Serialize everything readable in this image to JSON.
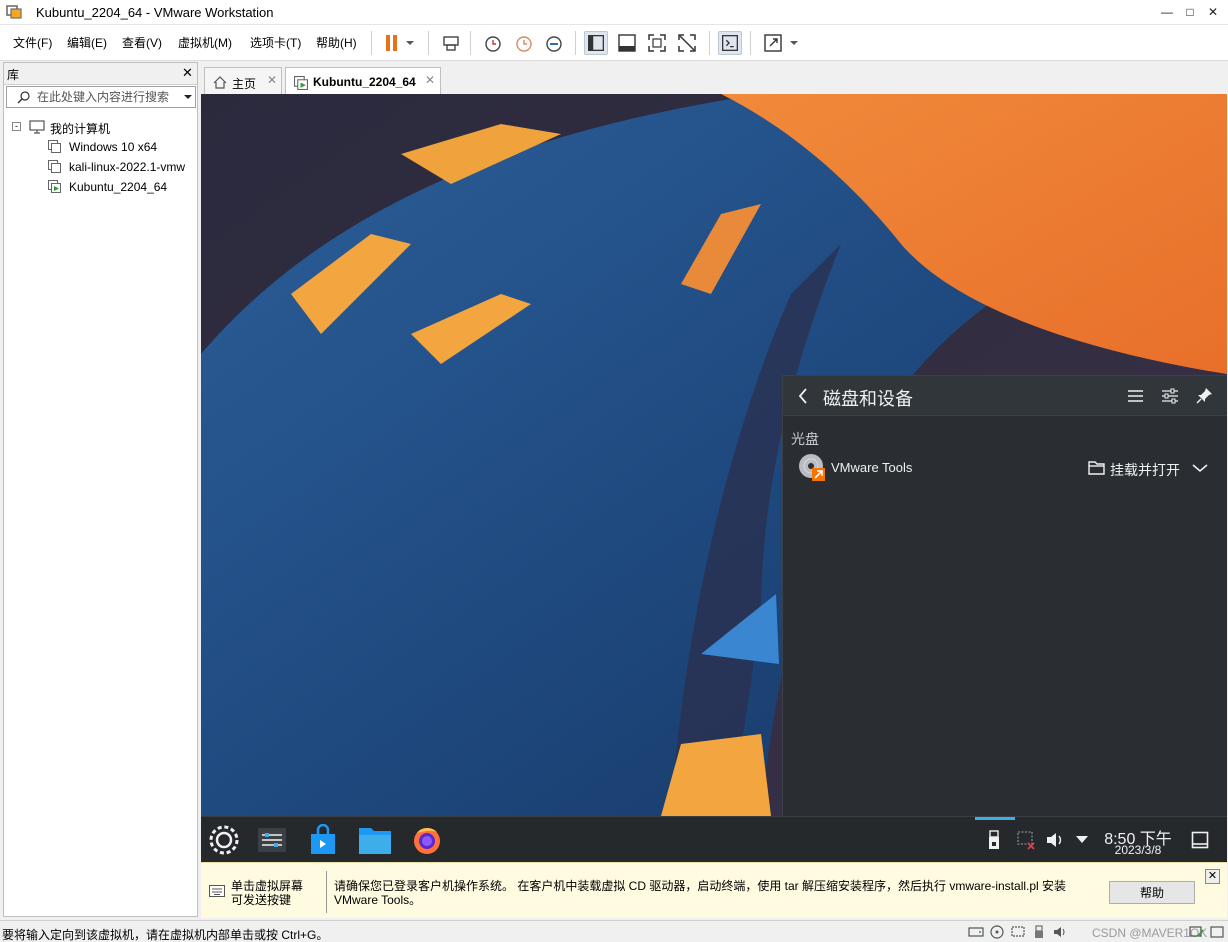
{
  "window": {
    "title": "Kubuntu_2204_64 - VMware Workstation"
  },
  "menu": [
    "文件(F)",
    "编辑(E)",
    "查看(V)",
    "虚拟机(M)",
    "选项卡(T)",
    "帮助(H)"
  ],
  "library": {
    "title": "库",
    "search_placeholder": "在此处键入内容进行搜索",
    "root": "我的计算机",
    "vms": [
      "Windows 10 x64",
      "kali-linux-2022.1-vmw",
      "Kubuntu_2204_64"
    ]
  },
  "tabs": [
    {
      "label": "主页",
      "icon": "home-icon"
    },
    {
      "label": "Kubuntu_2204_64",
      "icon": "vm-running-icon",
      "active": true
    }
  ],
  "guest": {
    "popup": {
      "title": "磁盘和设备",
      "section": "光盘",
      "device": "VMware Tools",
      "action": "挂载并打开"
    },
    "clock": {
      "time": "8:50 下午",
      "date": "2023/3/8"
    }
  },
  "hint": {
    "left": "单击虚拟屏幕\n可发送按键",
    "message": "请确保您已登录客户机操作系统。 在客户机中装载虚拟 CD 驱动器，启动终端，使用 tar 解压缩安装程序，然后执行 vmware-install.pl 安装 VMware Tools。",
    "help_button": "帮助"
  },
  "status": {
    "text": "要将输入定向到该虚拟机，请在虚拟机内部单击或按 Ctrl+G。",
    "watermark": "CSDN @MAVER1OK"
  },
  "colors": {
    "accent": "#3daee9",
    "kde_panel": "#26292c",
    "popup_bg": "#2a2e32",
    "pause_orange": "#e8711c"
  }
}
